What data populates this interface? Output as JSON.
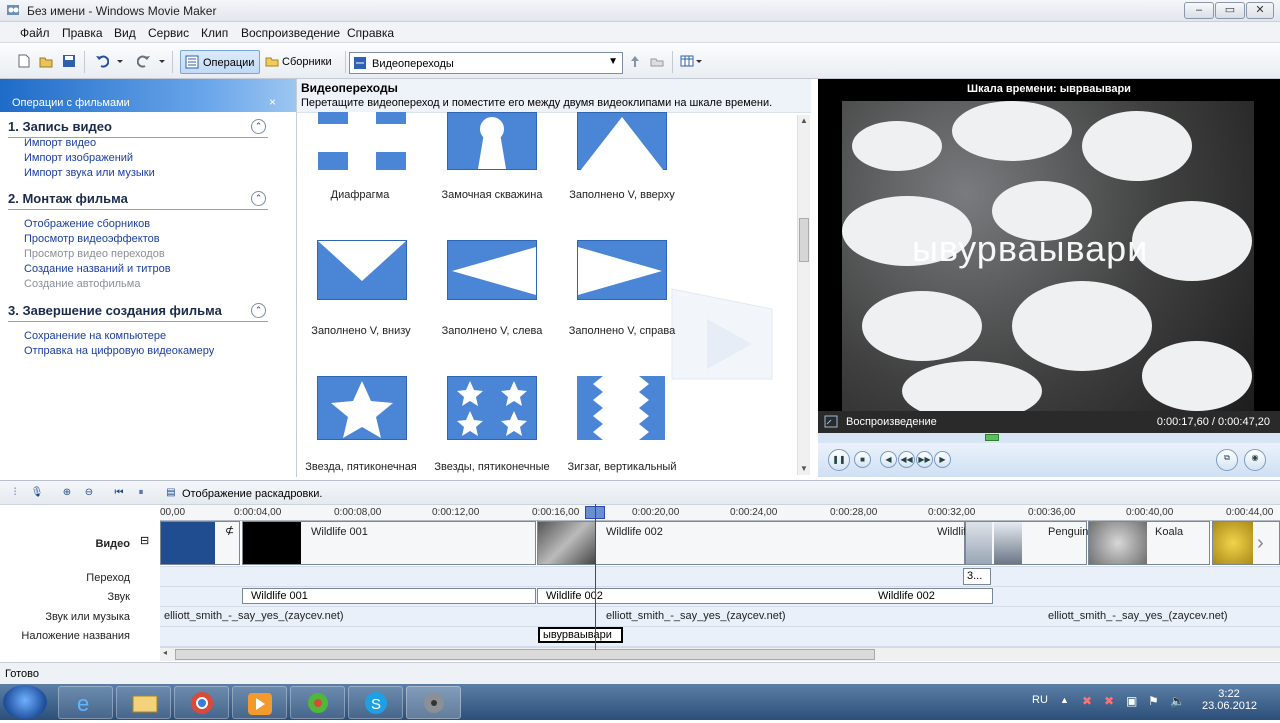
{
  "window": {
    "title": "Без имени - Windows Movie Maker",
    "min": "‒",
    "max": "▭",
    "close": "✕"
  },
  "menu": [
    "Файл",
    "Правка",
    "Вид",
    "Сервис",
    "Клип",
    "Воспроизведение",
    "Справка"
  ],
  "toolbar": {
    "operations": "Операции",
    "collections": "Сборники",
    "dropdown_value": "Видеопереходы"
  },
  "taskpane": {
    "header": "Операции с фильмами",
    "close": "×",
    "toggle": "⌃",
    "sections": [
      {
        "title": "1. Запись видео",
        "links": [
          {
            "label": "Импорт видео",
            "enabled": true
          },
          {
            "label": "Импорт изображений",
            "enabled": true
          },
          {
            "label": "Импорт звука или музыки",
            "enabled": true
          }
        ]
      },
      {
        "title": "2. Монтаж фильма",
        "links": [
          {
            "label": "Отображение сборников",
            "enabled": true
          },
          {
            "label": "Просмотр видеоэффектов",
            "enabled": true
          },
          {
            "label": "Просмотр видео переходов",
            "enabled": false
          },
          {
            "label": "Создание названий и титров",
            "enabled": true
          },
          {
            "label": "Создание автофильма",
            "enabled": false
          }
        ]
      },
      {
        "title": "3. Завершение создания фильма",
        "links": [
          {
            "label": "Сохранение на компьютере",
            "enabled": true
          },
          {
            "label": "Отправка на цифровую видеокамеру",
            "enabled": true
          }
        ]
      }
    ]
  },
  "content": {
    "title": "Видеопереходы",
    "subtitle": "Перетащите видеопереход и поместите его между двумя видеоклипами на шкале времени.",
    "transitions": [
      "Диафрагма",
      "Замочная скважина",
      "Заполнено V, вверху",
      "Заполнено V, внизу",
      "Заполнено V, слева",
      "Заполнено V, справа",
      "Звезда, пятиконечная",
      "Звезды, пятиконечные",
      "Зигзаг, вертикальный"
    ]
  },
  "preview": {
    "title": "Шкала времени: ыврваывари",
    "caption": "ывурваывари",
    "status": "Воспроизведение",
    "time": "0:00:17,60 / 0:00:47,20",
    "position_fraction": 0.373
  },
  "timeline": {
    "storyboard_label": "Отображение раскадровки.",
    "tracks": [
      "Видео",
      "Переход",
      "Звук",
      "Звук или музыка",
      "Наложение названия"
    ],
    "collapse": "⊟",
    "ruler": [
      "00,00",
      "0:00:04,00",
      "0:00:08,00",
      "0:00:12,00",
      "0:00:16,00",
      "0:00:20,00",
      "0:00:24,00",
      "0:00:28,00",
      "0:00:32,00",
      "0:00:36,00",
      "0:00:40,00",
      "0:00:44,00"
    ],
    "video_clips": [
      "Wildlife 001",
      "Wildlife 002",
      "Wildlife",
      "Penguin...",
      "Koala"
    ],
    "transition_marker": "3...",
    "audio_clips": [
      "Wildlife 001",
      "Wildlife 002",
      "Wildlife 002"
    ],
    "music": [
      "elliott_smith_-_say_yes_(zaycev.net)",
      "elliott_smith_-_say_yes_(zaycev.net)",
      "elliott_smith_-_say_yes_(zaycev.net)"
    ],
    "title_clip": "ывурваывари"
  },
  "status": "Готово",
  "taskbar": {
    "lang": "RU",
    "time": "3:22",
    "date": "23.06.2012"
  }
}
